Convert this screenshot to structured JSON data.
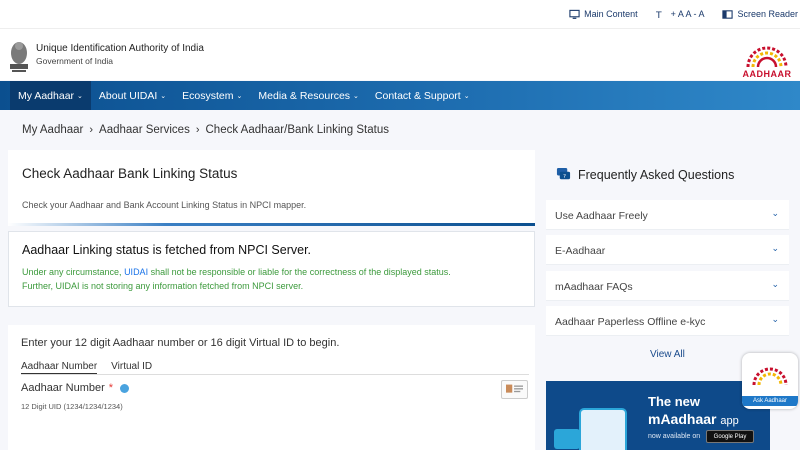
{
  "topbar": {
    "main_content": "Main Content",
    "text_size": "+ A A - A",
    "screen_reader": "Screen Reader"
  },
  "header": {
    "org_name": "Unique Identification Authority of India",
    "gov": "Government of India",
    "logo_text": "AADHAAR"
  },
  "nav": [
    {
      "label": "My Aadhaar",
      "active": true
    },
    {
      "label": "About UIDAI"
    },
    {
      "label": "Ecosystem"
    },
    {
      "label": "Media & Resources"
    },
    {
      "label": "Contact & Support"
    }
  ],
  "breadcrumb": [
    "My Aadhaar",
    "Aadhaar Services",
    "Check Aadhaar/Bank Linking Status"
  ],
  "page": {
    "title": "Check Aadhaar Bank Linking Status",
    "subtitle": "Check your Aadhaar and Bank Account Linking Status in NPCI mapper."
  },
  "notice": {
    "title": "Aadhaar Linking status is fetched from NPCI Server.",
    "msg_pre": "Under any circumstance,",
    "msg_uidai": "UIDAI",
    "msg_post": "shall not be responsible or liable for the correctness of the displayed status.",
    "msg_line2": "Further, UIDAI is not storing any information fetched from NPCI server."
  },
  "form": {
    "prompt": "Enter your 12 digit Aadhaar number or 16 digit Virtual ID to begin.",
    "tab_aadhaar": "Aadhaar Number",
    "tab_vid": "Virtual ID",
    "field_label": "Aadhaar Number",
    "required_mark": "*",
    "hint": "12 Digit UID (1234/1234/1234)"
  },
  "faq": {
    "title": "Frequently Asked Questions",
    "items": [
      "Use Aadhaar Freely",
      "E-Aadhaar",
      "mAadhaar FAQs",
      "Aadhaar Paperless Offline e-kyc"
    ],
    "view_all": "View All"
  },
  "promo": {
    "line1": "The new",
    "app_name": "mAadhaar",
    "app_suffix": "app",
    "available": "now available on",
    "store": "Google Play"
  },
  "ask": {
    "label": "Ask Aadhaar"
  },
  "colors": {
    "nav": "#0b4f8f",
    "accent_red": "#c8102e",
    "notice_green": "#3c9a3c"
  }
}
